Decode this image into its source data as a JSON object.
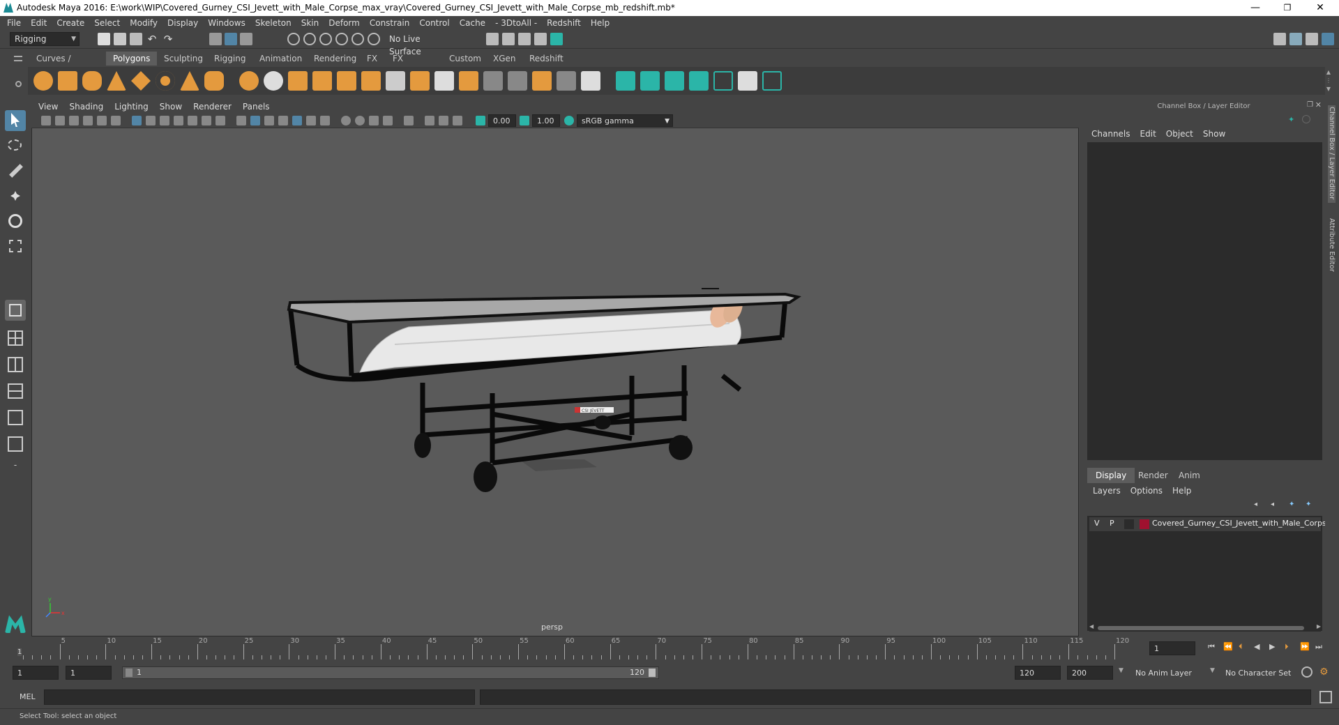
{
  "window": {
    "title": "Autodesk Maya 2016: E:\\work\\WIP\\Covered_Gurney_CSI_Jevett_with_Male_Corpse_max_vray\\Covered_Gurney_CSI_Jevett_with_Male_Corpse_mb_redshift.mb*",
    "minimize": "—",
    "restore": "❐",
    "close": "✕"
  },
  "menubar": [
    "File",
    "Edit",
    "Create",
    "Select",
    "Modify",
    "Display",
    "Windows",
    "Skeleton",
    "Skin",
    "Deform",
    "Constrain",
    "Control",
    "Cache",
    "- 3DtoAll -",
    "Redshift",
    "Help"
  ],
  "statusline": {
    "menuset": "Rigging",
    "live_surface": "No Live Surface"
  },
  "shelf": {
    "tabs": [
      "Curves / Surfaces",
      "Polygons",
      "Sculpting",
      "Rigging",
      "Animation",
      "Rendering",
      "FX",
      "FX Caching",
      "Custom",
      "XGen",
      "Redshift"
    ],
    "active_tab": "Polygons"
  },
  "viewport": {
    "menu": [
      "View",
      "Shading",
      "Lighting",
      "Show",
      "Renderer",
      "Panels"
    ],
    "exposure": "0.00",
    "gamma": "1.00",
    "color_space": "sRGB gamma",
    "camera_label": "persp",
    "axis_x": "x",
    "axis_y": "y",
    "gurney_label": "CSI JEVETT"
  },
  "channel_box": {
    "header": "Channel Box / Layer Editor",
    "menu": [
      "Channels",
      "Edit",
      "Object",
      "Show"
    ]
  },
  "layer_editor": {
    "tabs": [
      "Display",
      "Render",
      "Anim"
    ],
    "active_tab": "Display",
    "menu": [
      "Layers",
      "Options",
      "Help"
    ],
    "layer": {
      "v": "V",
      "p": "P",
      "name": "Covered_Gurney_CSI_Jevett_with_Male_Corpse",
      "color": "#a0112f"
    }
  },
  "side_tabs": [
    "Channel Box / Layer Editor",
    "Attribute Editor"
  ],
  "time_slider": {
    "ticks": [
      "5",
      "10",
      "15",
      "20",
      "25",
      "30",
      "35",
      "40",
      "45",
      "50",
      "55",
      "60",
      "65",
      "70",
      "75",
      "80",
      "85",
      "90",
      "95",
      "100",
      "105",
      "110",
      "115",
      "120"
    ],
    "first_tick": "1",
    "current_frame": "1"
  },
  "range": {
    "start": "1",
    "anim_start": "1",
    "range_start": "1",
    "range_end": "120",
    "end": "120",
    "anim_end": "200",
    "anim_layer": "No Anim Layer",
    "character_set": "No Character Set"
  },
  "command_line": {
    "lang": "MEL"
  },
  "help_line": "Select Tool: select an object",
  "colors": {
    "accent_teal": "#2bb5a8",
    "shelf_orange": "#e49a3e",
    "active_blue": "#5285a6"
  }
}
